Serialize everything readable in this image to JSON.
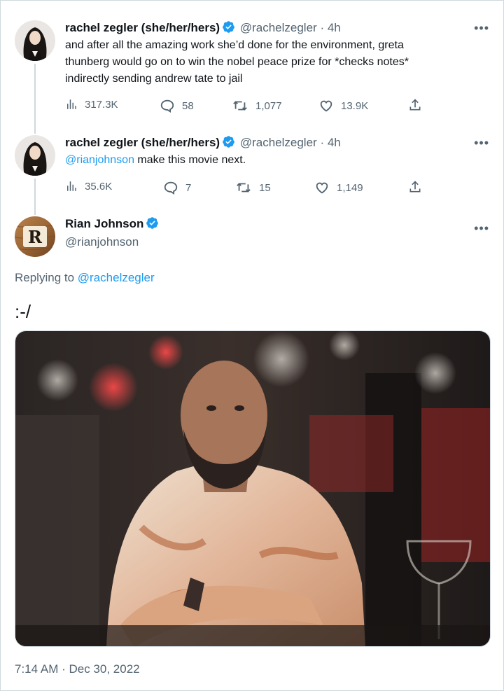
{
  "tweets": [
    {
      "name": "rachel zegler (she/her/hers)",
      "handle": "@rachelzegler",
      "separator": "·",
      "time": "4h",
      "lines": [
        "and after all the amazing work she’d done for the environment, greta",
        "thunberg would go on to win the nobel peace prize for *checks notes*",
        "indirectly sending andrew tate to jail"
      ],
      "views": "317.3K",
      "replies": "58",
      "retweets": "1,077",
      "likes": "13.9K"
    },
    {
      "name": "rachel zegler (she/her/hers)",
      "handle": "@rachelzegler",
      "separator": "·",
      "time": "4h",
      "mention": "@rianjohnson",
      "text_after": " make this movie next.",
      "views": "35.6K",
      "replies": "7",
      "retweets": "15",
      "likes": "1,149"
    }
  ],
  "main_tweet": {
    "name": "Rian Johnson",
    "handle": "@rianjohnson",
    "avatar_letter": "R",
    "replying_prefix": "Replying to ",
    "replying_handle": "@rachelzegler",
    "text": ":-/",
    "timestamp": "7:14 AM · Dec 30, 2022"
  },
  "colors": {
    "verified_blue": "#1d9bf0",
    "secondary_text": "#536471",
    "link": "#1d9bf0"
  },
  "icons": [
    "views-icon",
    "reply-icon",
    "retweet-icon",
    "like-icon",
    "share-icon",
    "verified-badge-icon",
    "more-icon"
  ]
}
